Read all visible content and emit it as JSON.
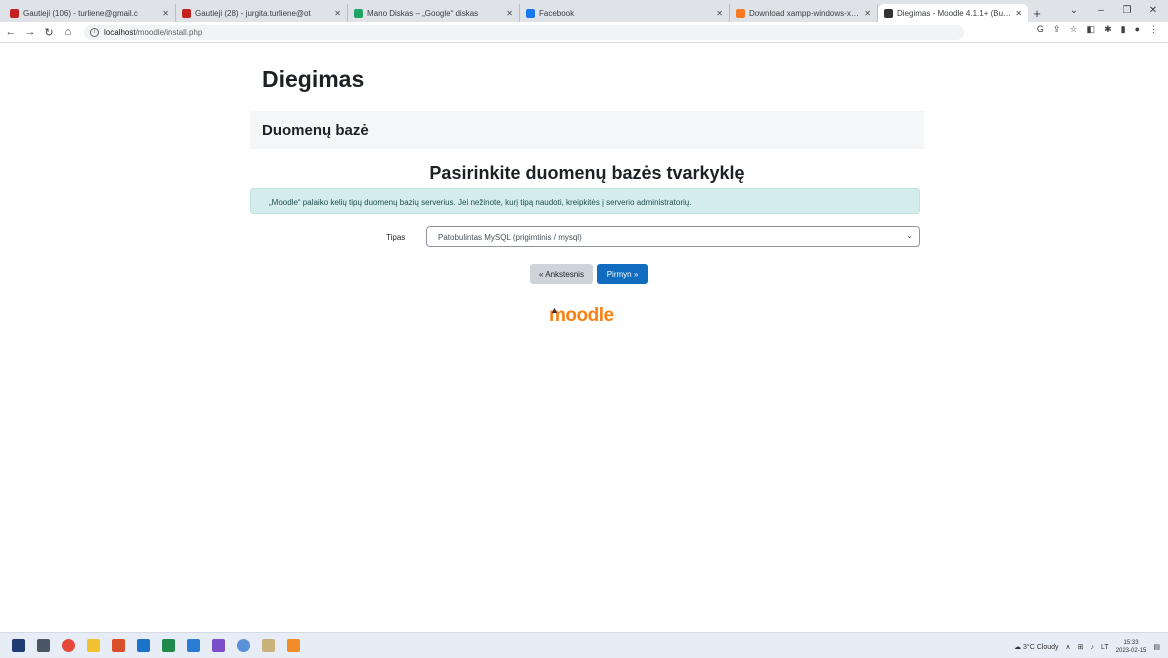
{
  "browser": {
    "tabs": [
      {
        "title": "Gautieji (106) - turliene@gmail.c",
        "favicon_color": "#c5221f",
        "active": false
      },
      {
        "title": "Gautieji (28) - jurgita.turliene@ot",
        "favicon_color": "#c5221f",
        "active": false
      },
      {
        "title": "Mano Diskas – „Google“ diskas",
        "favicon_color": "#1fa463",
        "active": false
      },
      {
        "title": "Facebook",
        "favicon_color": "#1877f2",
        "active": false
      },
      {
        "title": "Download xampp-windows-x64-",
        "favicon_color": "#fb7a24",
        "active": false
      },
      {
        "title": "Diegimas - Moodle 4.1.1+ (Build:",
        "favicon_color": "#333333",
        "active": true
      }
    ],
    "new_tab": "+",
    "window_controls": {
      "minimize": "–",
      "restore": "❐",
      "close": "✕",
      "tab_search": "⌄"
    },
    "address": {
      "host": "localhost",
      "path": "/moodle/install.php"
    }
  },
  "page": {
    "title": "Diegimas",
    "section": "Duomenų bazė",
    "heading": "Pasirinkite duomenų bazės tvarkyklę",
    "alert": "„Moodle“ palaiko kelių tipų duomenų bazių serverius. Jei nežinote, kurį tipą naudoti, kreipkitės į serverio administratorių.",
    "field_label": "Tipas",
    "select_value": "Patobulintas MySQL (prigimtinis / mysql)",
    "prev_button": "« Ankstesnis",
    "next_button": "Pirmyn »",
    "logo": "moodle",
    "colors": {
      "primary": "#0f6cbf",
      "logo": "#f98012",
      "alert_bg": "#d4ecec"
    }
  },
  "taskbar": {
    "weather": "3°C Cloudy",
    "language": "LT",
    "time": "15:33",
    "date": "2023-02-15"
  }
}
